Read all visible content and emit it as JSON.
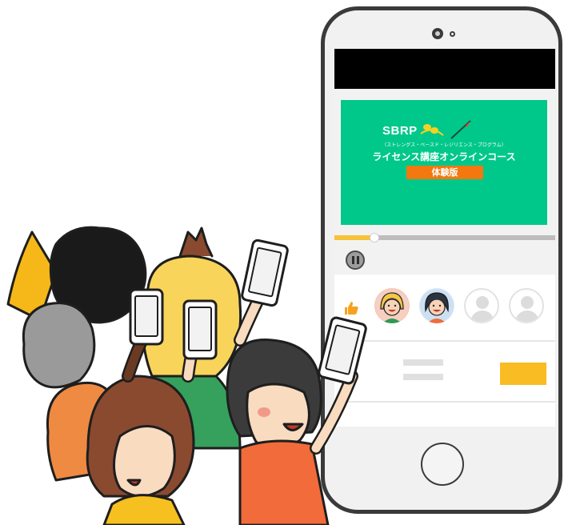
{
  "video": {
    "brand": "SBRP",
    "subtitle": "（ストレングス・ベースド・レジリエンス・プログラム）",
    "course_title": "ライセンス講座オンラインコース",
    "badge": "体験版",
    "progress": 0.18
  },
  "colors": {
    "video_bg": "#00c88a",
    "badge": "#f2780f",
    "accent_yellow": "#f9bc23",
    "like_icon": "#f7a11f"
  },
  "icons": {
    "like": "thumbs-up-icon",
    "pause": "pause-icon"
  }
}
